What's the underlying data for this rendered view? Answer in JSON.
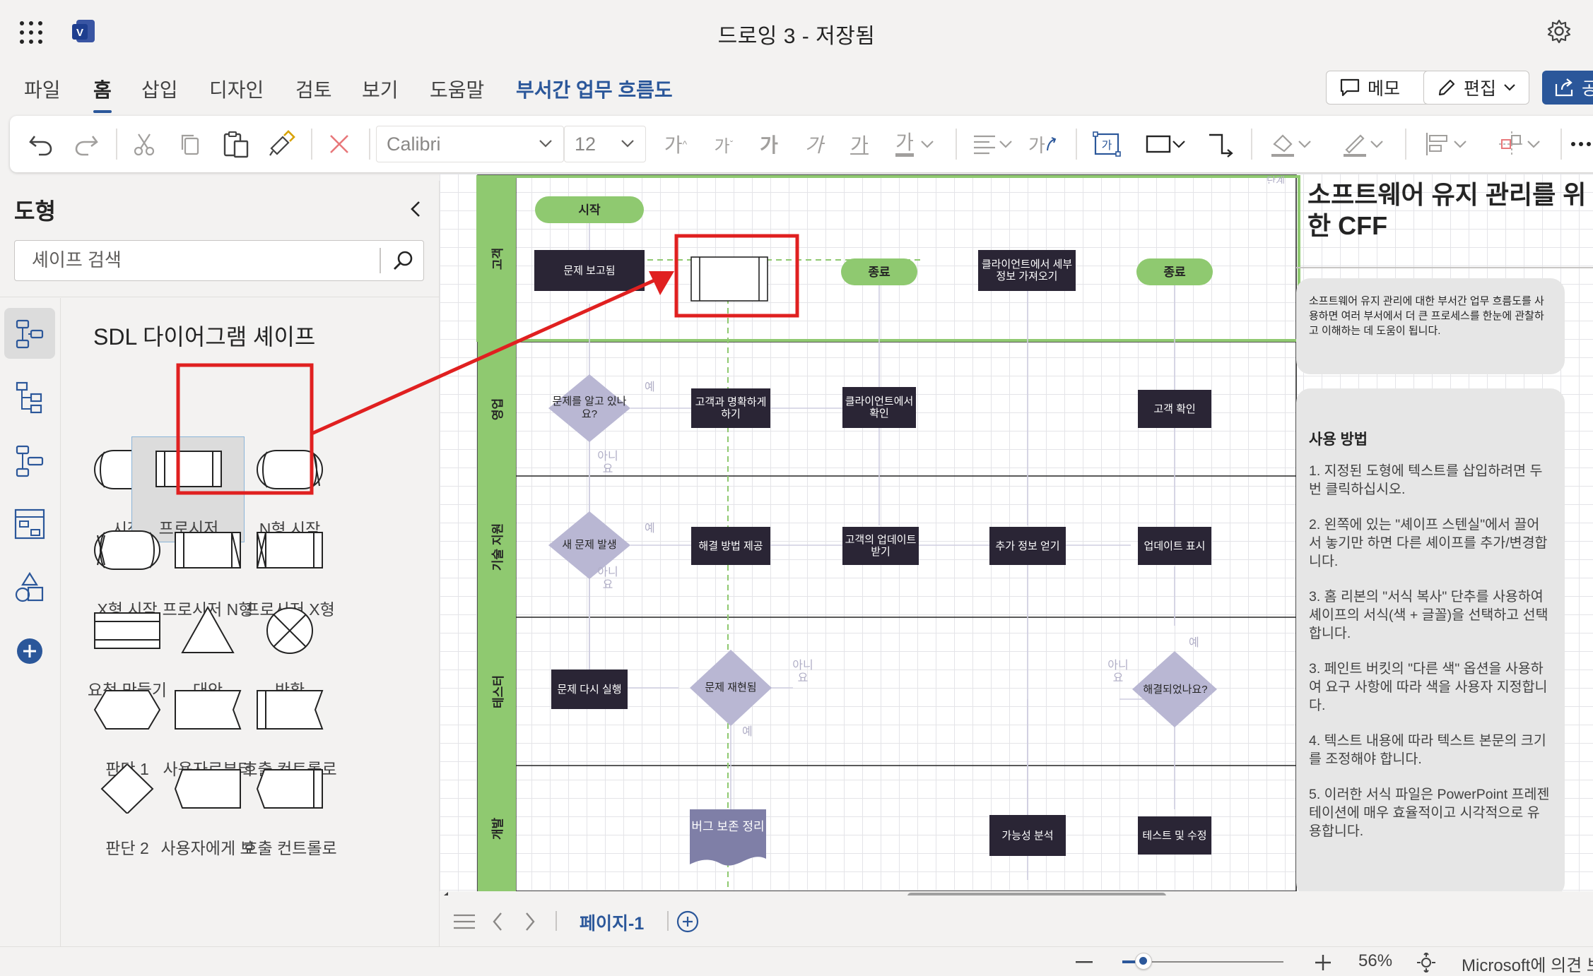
{
  "window": {
    "title": "드로잉 3  -  저장됨"
  },
  "tabs": [
    {
      "label": "파일"
    },
    {
      "label": "홈"
    },
    {
      "label": "삽입"
    },
    {
      "label": "디자인"
    },
    {
      "label": "검토"
    },
    {
      "label": "보기"
    },
    {
      "label": "도움말"
    },
    {
      "label": "부서간 업무 흐름도"
    }
  ],
  "top_actions": {
    "memo": "메모",
    "edit": "편집",
    "share": "공"
  },
  "ribbon": {
    "font": "Calibri",
    "size": "12",
    "glyph": "가",
    "shape_text_glyph": "가"
  },
  "shapes_panel": {
    "title": "도형",
    "search_placeholder": "셰이프 검색",
    "stencil_title": "SDL 다이어그램 셰이프",
    "shapes": [
      "시작",
      "프로시저",
      "N형 시작",
      "X형 시작",
      "프로시저 N형",
      "프로시저 X형",
      "요청 만들기",
      "대안",
      "반환",
      "판단 1",
      "사용자로부터",
      "호출 컨트롤로",
      "판단 2",
      "사용자에게 보",
      "호출 컨트롤로"
    ]
  },
  "diagram": {
    "lanes": [
      "고객",
      "영업",
      "기술 지원",
      "테스터",
      "개발"
    ],
    "nodes": {
      "start": "시작",
      "problem_reported": "문제 보고됨",
      "end1": "종료",
      "get_client_info": "클라이언트에서 세부 정보 가져오기",
      "end2": "종료",
      "know_problem": "문제를 알고 있나요?",
      "clarify": "고객과 명확하게 하기",
      "client_confirm": "클라이언트에서 확인",
      "customer_confirm": "고객 확인",
      "new_problem": "새 문제 발생",
      "provide_solution": "해결 방법 제공",
      "customer_update": "고객의 업데이트 받기",
      "get_more_info": "추가 정보 얻기",
      "show_update": "업데이트 표시",
      "rerun_problem": "문제 다시 실행",
      "reproduced": "문제 재현됨",
      "resolved": "해결되었나요?",
      "bug_report": "버그 보존 정리",
      "feasibility": "가능성 분석",
      "test_fix": "테스트 및 수정"
    },
    "labels": {
      "yes": "예",
      "no": "아니요",
      "corner": "단계"
    }
  },
  "info_panel": {
    "title": "소프트웨어 유지 관리를 위한 CFF",
    "intro": "소프트웨어 유지 관리에 대한 부서간 업무 흐름도를 사용하면 여러 부서에서 더 큰 프로세스를 한눈에 관찰하고 이해하는 데 도움이 됩니다.",
    "howto_title": "사용 방법",
    "steps": [
      "1. 지정된 도형에 텍스트를 삽입하려면 두 번 클릭하십시오.",
      "2. 왼쪽에 있는 \"셰이프 스텐실\"에서 끌어서 놓기만 하면 다른 셰이프를 추가/변경합니다.",
      "3. 홈 리본의 \"서식 복사\" 단추를 사용하여 셰이프의 서식(색 + 글꼴)을 선택하고 선택합니다.",
      "3. 페인트 버킷의 \"다른 색\" 옵션을 사용하여 요구 사항에 따라 색을 사용자 지정합니다.",
      "4. 텍스트 내용에 따라 텍스트 본문의 크기를 조정해야 합니다.",
      "5. 이러한 서식 파일은 PowerPoint 프레젠테이션에 매우 효율적이고 시각적으로 유용합니다."
    ]
  },
  "pagebar": {
    "page_tab": "페이지-1"
  },
  "statusbar": {
    "zoom": "56%",
    "feedback": "Microsoft에 의견 보"
  },
  "colors": {
    "accent": "#2b579a",
    "lane_green": "#8fc970",
    "process_dark": "#2a2535",
    "decision": "#b9b7d3",
    "annotation_red": "#e02020"
  }
}
